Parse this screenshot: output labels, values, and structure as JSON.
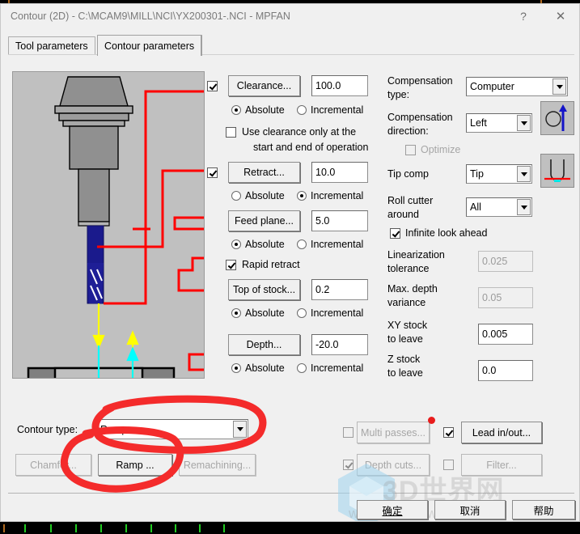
{
  "window": {
    "title": "Contour (2D) - C:\\MCAM9\\MILL\\NCI\\YX200301-.NCI - MPFAN",
    "help_icon": "?",
    "close_icon": "✕"
  },
  "tabs": [
    {
      "label": "Tool parameters",
      "active": false
    },
    {
      "label": "Contour parameters",
      "active": true
    }
  ],
  "heights": {
    "clearance": {
      "checkbox_checked": true,
      "button_label": "Clearance...",
      "value": "100.0",
      "mode": "Absolute",
      "absolute_label": "Absolute",
      "incremental_label": "Incremental"
    },
    "use_clearance_only": {
      "checked": false,
      "line1": "Use clearance only at the",
      "line2": "start and end of operation"
    },
    "retract": {
      "checkbox_checked": true,
      "button_label": "Retract...",
      "value": "10.0",
      "mode": "Incremental",
      "absolute_label": "Absolute",
      "incremental_label": "Incremental"
    },
    "feed_plane": {
      "button_label": "Feed plane...",
      "value": "5.0",
      "mode": "Absolute",
      "absolute_label": "Absolute",
      "incremental_label": "Incremental"
    },
    "rapid_retract": {
      "checked": true,
      "label": "Rapid retract"
    },
    "top_of_stock": {
      "button_label": "Top of stock...",
      "value": "0.2",
      "mode": "Absolute",
      "absolute_label": "Absolute",
      "incremental_label": "Incremental"
    },
    "depth": {
      "button_label": "Depth...",
      "value": "-20.0",
      "mode": "Absolute",
      "absolute_label": "Absolute",
      "incremental_label": "Incremental"
    }
  },
  "compensation": {
    "type_label_l1": "Compensation",
    "type_label_l2": "type:",
    "type_value": "Computer",
    "direction_label_l1": "Compensation",
    "direction_label_l2": "direction:",
    "direction_value": "Left",
    "optimize_label": "Optimize",
    "optimize_checked": false,
    "optimize_disabled": true,
    "tip_comp_label": "Tip comp",
    "tip_comp_value": "Tip",
    "roll_cutter_l1": "Roll cutter",
    "roll_cutter_l2": "around",
    "roll_cutter_value": "All",
    "infinite_look_ahead_label": "Infinite look ahead",
    "infinite_look_ahead_checked": true,
    "linearization_l1": "Linearization",
    "linearization_l2": "tolerance",
    "linearization_value": "0.025",
    "max_depth_l1": "Max. depth",
    "max_depth_l2": "variance",
    "max_depth_value": "0.05",
    "xy_stock_l1": "XY stock",
    "xy_stock_l2": "to leave",
    "xy_stock_value": "0.005",
    "z_stock_l1": "Z stock",
    "z_stock_l2": "to leave",
    "z_stock_value": "0.0",
    "direction_icon": "cutter-comp-left-icon",
    "tip_comp_icon": "tip-comp-icon"
  },
  "contour": {
    "type_label": "Contour type:",
    "type_value": "Ramp",
    "chamfer_label": "Chamfer...",
    "ramp_label": "Ramp ...",
    "remachining_label": "Remachining..."
  },
  "options": {
    "multi_passes": {
      "label": "Multi passes...",
      "checked": false,
      "disabled": true
    },
    "depth_cuts": {
      "label": "Depth cuts...",
      "checked": true,
      "disabled": true
    },
    "lead_in_out": {
      "label": "Lead in/out...",
      "checked": true,
      "disabled": false
    },
    "filter": {
      "label": "Filter...",
      "checked": false,
      "disabled": true
    }
  },
  "footer": {
    "ok_label": "确定",
    "cancel_label": "取消",
    "help_label": "帮助"
  },
  "watermark": {
    "text": "3D世界网",
    "url": "www.3ds.w.c"
  },
  "annotation": {
    "color": "#f42b2b",
    "note": "hand-drawn red ellipses around Contour type combo and Ramp button"
  },
  "colors": {
    "dialog_bg": "#f0f0f0",
    "preview_bg": "#c0c0c0",
    "toolpath_red": "#ff0000",
    "rapid_yellow": "#ffff00",
    "feed_cyan": "#00ffff",
    "tool_blue": "#1a1a8c",
    "annotation_red": "#f42b2b"
  }
}
